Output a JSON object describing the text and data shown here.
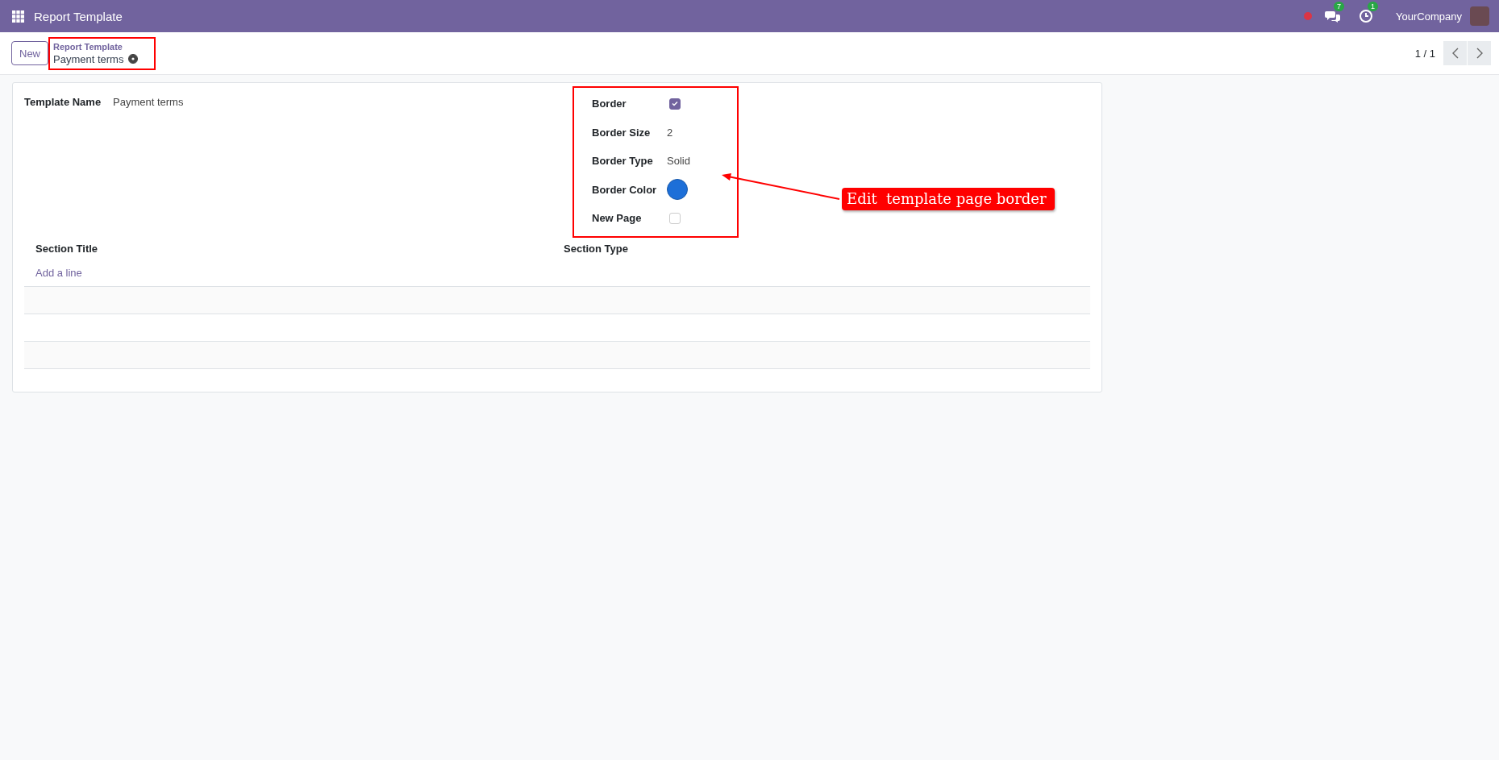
{
  "navbar": {
    "app_title": "Report Template",
    "messages_count": "7",
    "activities_count": "1",
    "company": "YourCompany"
  },
  "control_panel": {
    "new_button": "New",
    "breadcrumb_parent": "Report Template",
    "breadcrumb_current": "Payment terms",
    "pager": "1 / 1"
  },
  "form": {
    "template_name_label": "Template Name",
    "template_name_value": "Payment terms",
    "fields": [
      {
        "kind": "checkbox",
        "label": "Border",
        "checked": true
      },
      {
        "kind": "text",
        "label": "Border Size",
        "value": "2"
      },
      {
        "kind": "text",
        "label": "Border Type",
        "value": "Solid"
      },
      {
        "kind": "color",
        "label": "Border Color",
        "color": "#1d6fd8"
      },
      {
        "kind": "checkbox",
        "label": "New Page",
        "checked": false
      }
    ],
    "table": {
      "columns": [
        "Section Title",
        "Section Type"
      ],
      "add_line": "Add a line"
    }
  },
  "annotation": {
    "text": "Edit  template page border"
  }
}
